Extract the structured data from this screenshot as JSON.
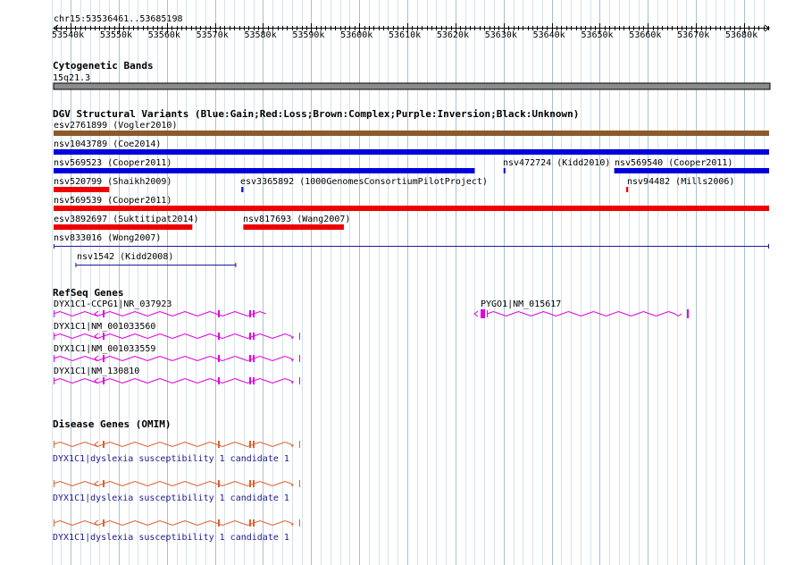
{
  "coordinate_label": "chr15:53536461..53685198",
  "ruler": {
    "start": 53536461,
    "end": 53685198,
    "ticks": [
      "53540k",
      "53550k",
      "53560k",
      "53570k",
      "53580k",
      "53590k",
      "53600k",
      "53610k",
      "53620k",
      "53630k",
      "53640k",
      "53650k",
      "53660k",
      "53670k",
      "53680k"
    ],
    "tick_values": [
      53540000,
      53550000,
      53560000,
      53570000,
      53580000,
      53590000,
      53600000,
      53610000,
      53620000,
      53630000,
      53640000,
      53650000,
      53660000,
      53670000,
      53680000
    ]
  },
  "cyto": {
    "title": "Cytogenetic Bands",
    "band_label": "15q21.3",
    "color": "#8c8c8c"
  },
  "dgv": {
    "title": "DGV Structural Variants (Blue:Gain;Red:Loss;Brown:Complex;Purple:Inversion;Black:Unknown)",
    "colors": {
      "gain": "#0000dd",
      "loss": "#ee0000",
      "complex": "#8b5a2b",
      "unknown": "#1a1a9a"
    },
    "variants": [
      {
        "label": "esv2761899 (Vogler2010)",
        "type": "complex",
        "start": 53536461,
        "end": 53685198
      },
      {
        "label": "nsv1043789 (Coe2014)",
        "type": "gain",
        "start": 53536461,
        "end": 53685198
      },
      {
        "label": "nsv569523 (Cooper2011)",
        "type": "gain",
        "start": 53536461,
        "end": 53624000
      },
      {
        "label": "nsv472724 (Kidd2010)",
        "type": "gain",
        "start": 53630000,
        "end": 53630300
      },
      {
        "label": "nsv569540 (Cooper2011)",
        "type": "gain",
        "start": 53653000,
        "end": 53685198
      },
      {
        "label": "nsv520799 (Shaikh2009)",
        "type": "loss",
        "start": 53536461,
        "end": 53548000
      },
      {
        "label": "esv3365892 (1000GenomesConsortiumPilotProject)",
        "type": "gain",
        "start": 53575500,
        "end": 53575900
      },
      {
        "label": "nsv94482 (Mills2006)",
        "type": "loss",
        "start": 53655500,
        "end": 53655900
      },
      {
        "label": "nsv569539 (Cooper2011)",
        "type": "loss",
        "start": 53536461,
        "end": 53685198
      },
      {
        "label": "esv3892697 (Suktitipat2014)",
        "type": "loss",
        "start": 53536461,
        "end": 53565300
      },
      {
        "label": "nsv817693 (Wang2007)",
        "type": "loss",
        "start": 53575900,
        "end": 53596800
      },
      {
        "label": "nsv833016 (Wong2007)",
        "type": "unknown",
        "start": 53536461,
        "end": 53685198
      },
      {
        "label": "nsv1542 (Kidd2008)",
        "type": "unknown",
        "start": 53541000,
        "end": 53574400
      }
    ]
  },
  "refseq": {
    "title": "RefSeq Genes",
    "color": "#e000e0",
    "genes": [
      {
        "label": "DYX1C1-CCPG1|NR_037923",
        "start": 53536461,
        "end": 53580600
      },
      {
        "label": "PYGO1|NM_015617",
        "start": 53626600,
        "end": 53667000
      },
      {
        "label": "DYX1C1|NM_001033560",
        "start": 53536461,
        "end": 53586300
      },
      {
        "label": "DYX1C1|NM_001033559",
        "start": 53536461,
        "end": 53586300
      },
      {
        "label": "DYX1C1|NM_130810",
        "start": 53536461,
        "end": 53586300
      }
    ]
  },
  "omim": {
    "title": "Disease Genes (OMIM)",
    "color": "#e06030",
    "genes": [
      {
        "label": "DYX1C1|dyslexia susceptibility 1 candidate 1",
        "start": 53536461,
        "end": 53586300
      },
      {
        "label": "DYX1C1|dyslexia susceptibility 1 candidate 1",
        "start": 53536461,
        "end": 53586300
      },
      {
        "label": "DYX1C1|dyslexia susceptibility 1 candidate 1",
        "start": 53536461,
        "end": 53586300
      }
    ]
  }
}
